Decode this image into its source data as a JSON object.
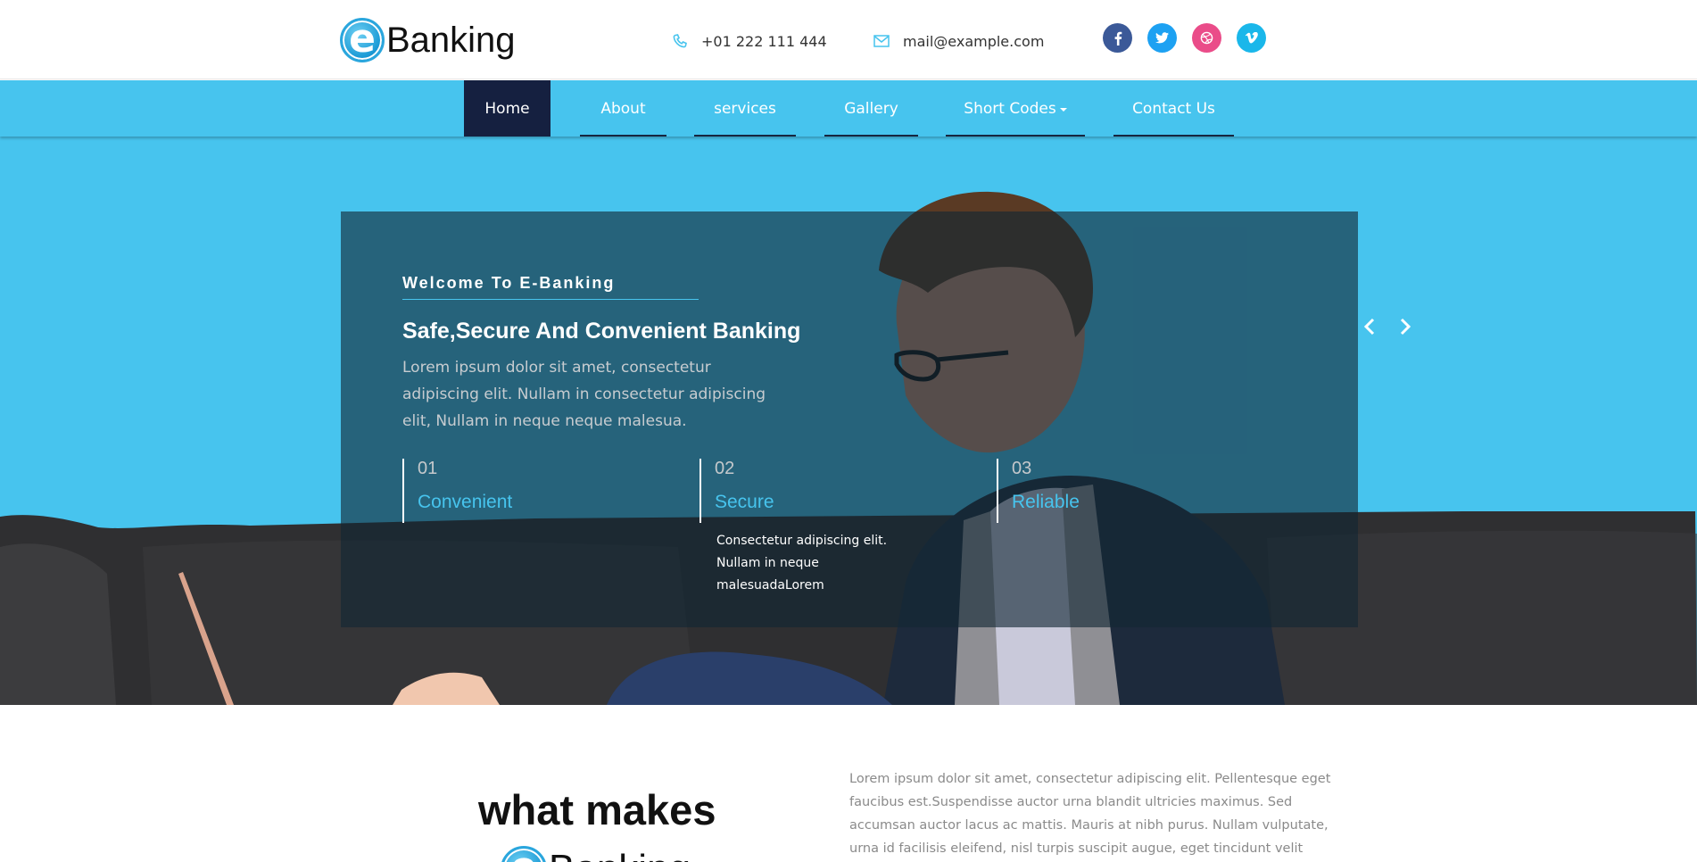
{
  "header": {
    "logo_letter": "e",
    "logo_text": "Banking",
    "phone": "+01 222 111 444",
    "email": "mail@example.com",
    "socials": [
      "facebook-icon",
      "twitter-icon",
      "dribbble-icon",
      "vimeo-icon"
    ]
  },
  "nav": {
    "items": [
      {
        "label": "Home",
        "active": true
      },
      {
        "label": "About"
      },
      {
        "label": "services"
      },
      {
        "label": "Gallery"
      },
      {
        "label": "Short Codes",
        "dropdown": true
      },
      {
        "label": "Contact Us"
      }
    ]
  },
  "hero": {
    "welcome": "Welcome To E-Banking",
    "headline": "Safe,Secure And Convenient Banking",
    "lead": "Lorem ipsum dolor sit amet, consectetur adipiscing elit. Nullam in consectetur adipiscing elit, Nullam in neque neque malesua.",
    "features": [
      {
        "num": "01",
        "title": "Convenient",
        "desc": ""
      },
      {
        "num": "02",
        "title": "Secure",
        "desc": "Consectetur adipiscing elit. Nullam in neque malesuadaLorem"
      },
      {
        "num": "03",
        "title": "Reliable",
        "desc": ""
      }
    ]
  },
  "about": {
    "title": "what makes",
    "logo_letter": "e",
    "logo_text": "Banking",
    "text": "Lorem ipsum dolor sit amet, consectetur adipiscing elit. Pellentesque eget faucibus est.Suspendisse auctor urna blandit ultricies maximus. Sed accumsan auctor lacus ac mattis. Mauris at nibh purus. Nullam vulputate, urna id facilisis eleifend, nisl turpis suscipit augue, eget tincidunt velit nunc ut lectus.Morbi rutrum ut risus sed"
  },
  "colors": {
    "accent": "#47c4ee",
    "nav_active": "#152040",
    "panel": "#122634"
  }
}
